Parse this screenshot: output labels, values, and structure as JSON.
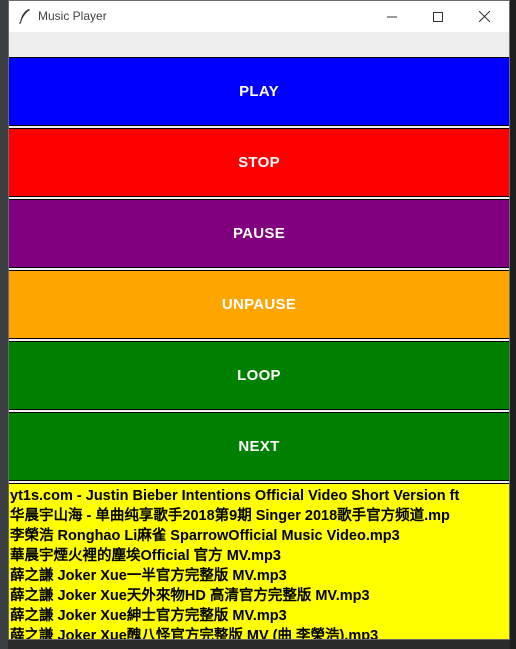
{
  "window": {
    "title": "Music Player"
  },
  "buttons": [
    {
      "id": "play",
      "label": "PLAY",
      "color": "#0000ff"
    },
    {
      "id": "stop",
      "label": "STOP",
      "color": "#ff0000"
    },
    {
      "id": "pause",
      "label": "PAUSE",
      "color": "#800080"
    },
    {
      "id": "unpause",
      "label": "UNPAUSE",
      "color": "#ffa500"
    },
    {
      "id": "loop",
      "label": "LOOP",
      "color": "#008000"
    },
    {
      "id": "next",
      "label": "NEXT",
      "color": "#008000"
    }
  ],
  "playlist": {
    "background": "#ffff00",
    "items": [
      "yt1s.com - Justin Bieber  Intentions Official Video Short Version ft",
      "华晨宇山海 - 单曲纯享歌手2018第9期 Singer 2018歌手官方频道.mp",
      "李榮浩 Ronghao Li麻雀 SparrowOfficial Music Video.mp3",
      "華晨宇煙火裡的塵埃Official 官方 MV.mp3",
      "薛之謙 Joker Xue一半官方完整版 MV.mp3",
      "薛之謙 Joker Xue天外來物HD 高清官方完整版 MV.mp3",
      "薛之謙 Joker Xue紳士官方完整版 MV.mp3",
      "薛之謙 Joker Xue醜八怪官方完整版 MV (曲 李榮浩).mp3"
    ]
  }
}
